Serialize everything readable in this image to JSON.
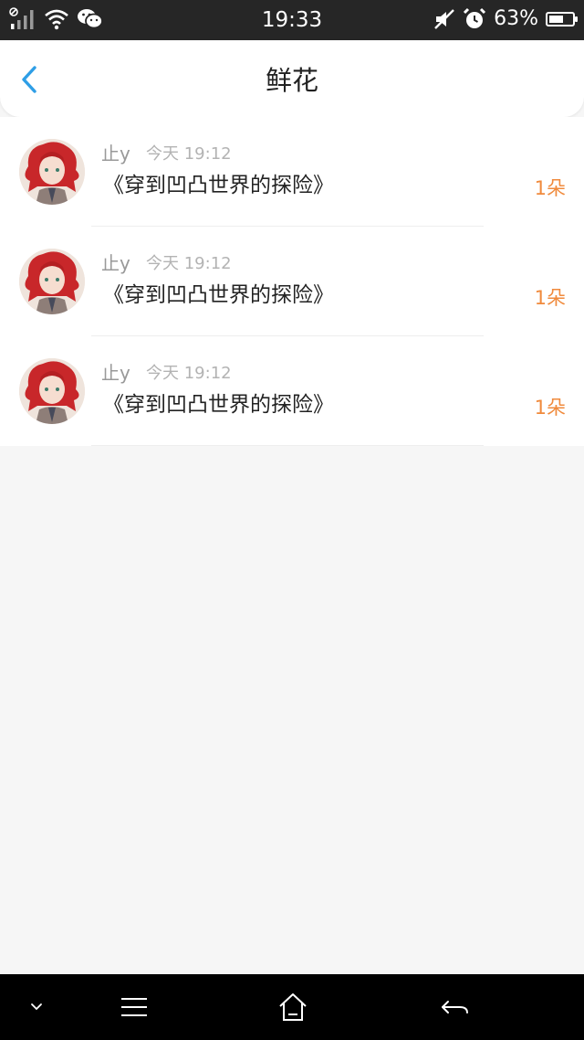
{
  "status_bar": {
    "time": "19:33",
    "battery_percent": "63%",
    "battery_level": 0.63,
    "icons": [
      "signal-icon",
      "wifi-icon",
      "wechat-icon",
      "mute-icon",
      "alarm-icon",
      "battery-icon"
    ]
  },
  "header": {
    "title": "鲜花",
    "back_icon": "chevron-left-icon",
    "accent_color": "#2e9ee6"
  },
  "items": [
    {
      "user": "止y",
      "time": "今天 19:12",
      "book": "《穿到凹凸世界的探险》",
      "count": "1朵"
    },
    {
      "user": "止y",
      "time": "今天 19:12",
      "book": "《穿到凹凸世界的探险》",
      "count": "1朵"
    },
    {
      "user": "止y",
      "time": "今天 19:12",
      "book": "《穿到凹凸世界的探险》",
      "count": "1朵"
    }
  ],
  "nav": {
    "icons": [
      "chevron-down-icon",
      "menu-icon",
      "home-icon",
      "back-arrow-icon"
    ]
  }
}
